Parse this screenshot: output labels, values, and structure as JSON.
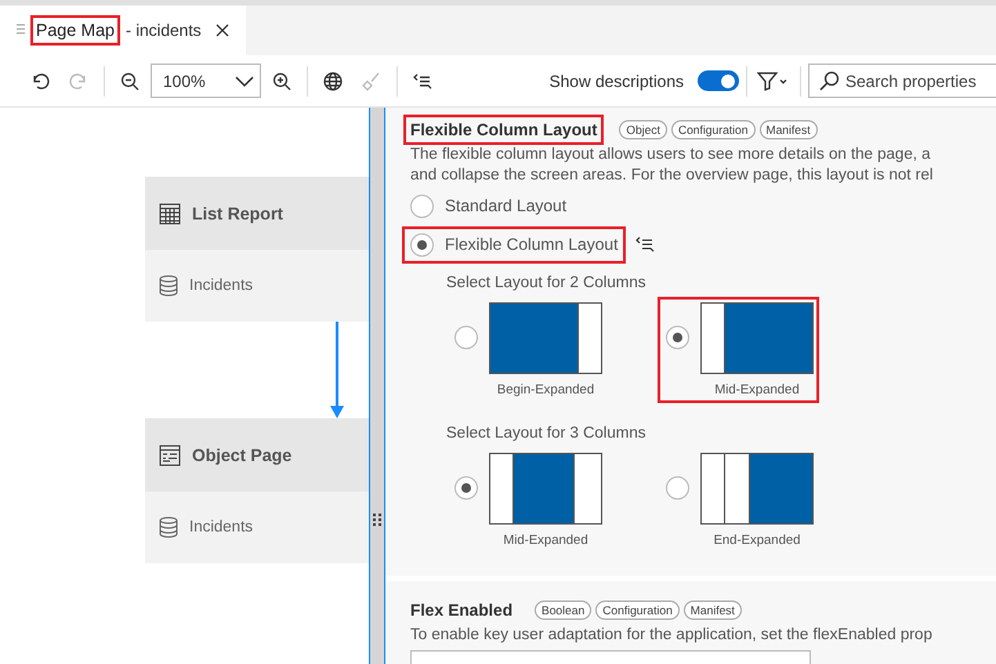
{
  "tab": {
    "label_main": "Page Map",
    "label_rest": "- incidents",
    "main_highlighted": true
  },
  "toolbar": {
    "zoom": "100%",
    "show_descriptions": {
      "label": "Show descriptions",
      "on": true
    },
    "search": {
      "placeholder": "Search properties"
    },
    "redo_disabled": true,
    "clean_disabled": true
  },
  "page_map": [
    {
      "kind": "list",
      "title": "List Report",
      "entity": "Incidents"
    },
    {
      "kind": "object",
      "title": "Object Page",
      "entity": "Incidents"
    }
  ],
  "sections": [
    {
      "kind": "choice",
      "title": "Flexible Column Layout",
      "highlighted": true,
      "tags": [
        "Object",
        "Configuration",
        "Manifest"
      ],
      "description": [
        "The flexible column layout allows users to see more details on the page, a",
        "and collapse the screen areas. For the overview page, this layout is not rel"
      ],
      "options": [
        {
          "label": "Standard Layout",
          "selected": false,
          "highlighted": false
        },
        {
          "label": "Flexible Column Layout",
          "selected": true,
          "highlighted": true
        }
      ],
      "groups": [
        {
          "label": "Select Layout for 2 Columns",
          "layouts": [
            {
              "kind": "begin",
              "caption": "Begin-Expanded",
              "selected": false,
              "highlighted": false
            },
            {
              "kind": "mid2",
              "caption": "Mid-Expanded",
              "selected": true,
              "highlighted": true
            }
          ]
        },
        {
          "label": "Select Layout for 3 Columns",
          "layouts": [
            {
              "kind": "mid3",
              "caption": "Mid-Expanded",
              "selected": true,
              "highlighted": false
            },
            {
              "kind": "end",
              "caption": "End-Expanded",
              "selected": false,
              "highlighted": false
            }
          ]
        }
      ]
    },
    {
      "kind": "boolean",
      "title": "Flex Enabled",
      "highlighted": false,
      "tags": [
        "Boolean",
        "Configuration",
        "Manifest"
      ],
      "description": [
        "To enable key user adaptation for the application, set the flexEnabled prop"
      ]
    }
  ]
}
